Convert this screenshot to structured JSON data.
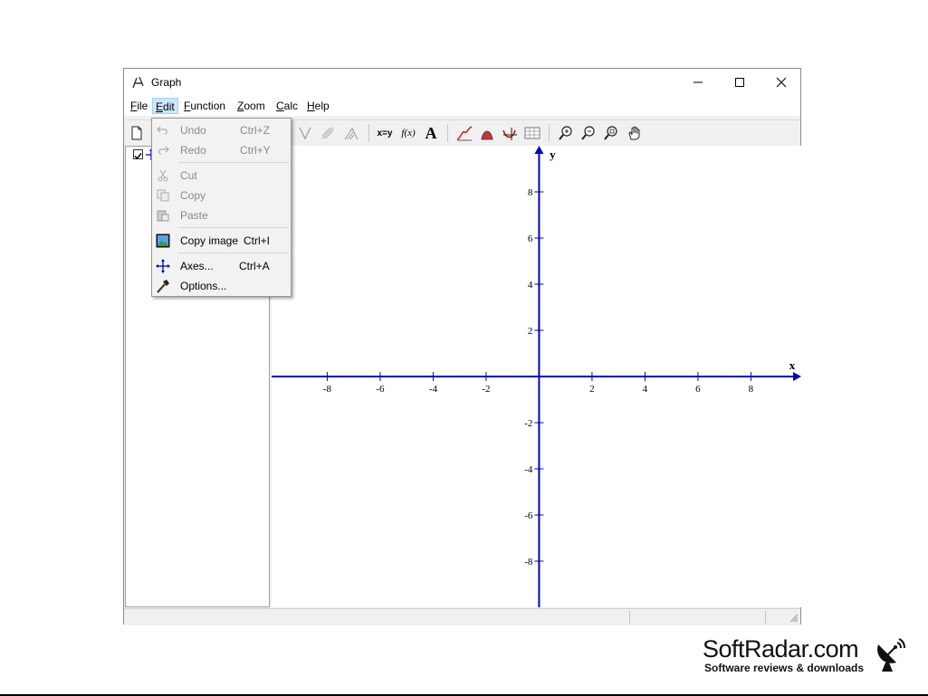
{
  "window": {
    "title": "Graph",
    "app_icon": "graph-app-icon"
  },
  "window_controls": {
    "minimize": "minimize-icon",
    "maximize": "maximize-icon",
    "close": "close-icon"
  },
  "menubar": {
    "items": [
      {
        "label": "File",
        "hotkey": "F",
        "rest": "ile"
      },
      {
        "label": "Edit",
        "hotkey": "E",
        "rest": "dit"
      },
      {
        "label": "Function",
        "hotkey": "F",
        "rest": "unction"
      },
      {
        "label": "Zoom",
        "hotkey": "Z",
        "rest": "oom"
      },
      {
        "label": "Calc",
        "hotkey": "C",
        "rest": "alc"
      },
      {
        "label": "Help",
        "hotkey": "H",
        "rest": "elp"
      }
    ]
  },
  "edit_menu": {
    "items": [
      {
        "label": "Undo",
        "shortcut": "Ctrl+Z",
        "enabled": false,
        "icon": "undo-icon"
      },
      {
        "label": "Redo",
        "shortcut": "Ctrl+Y",
        "enabled": false,
        "icon": "redo-icon"
      },
      {
        "label": "Cut",
        "shortcut": "",
        "enabled": false,
        "icon": "scissors-icon"
      },
      {
        "label": "Copy",
        "shortcut": "",
        "enabled": false,
        "icon": "copy-icon"
      },
      {
        "label": "Paste",
        "shortcut": "",
        "enabled": false,
        "icon": "paste-icon"
      },
      {
        "label": "Copy image",
        "shortcut": "Ctrl+I",
        "enabled": true,
        "icon": "image-icon"
      },
      {
        "label": "Axes...",
        "shortcut": "Ctrl+A",
        "enabled": true,
        "icon": "axes-icon"
      },
      {
        "label": "Options...",
        "shortcut": "",
        "enabled": true,
        "icon": "hammer-icon"
      }
    ]
  },
  "toolbar": {
    "icons": [
      "new-file-icon",
      "tangent-icon",
      "relation-icon",
      "shading-icon",
      "insert-point-series-icon",
      "evaluate-xy-label",
      "evaluate-fx-label",
      "insert-text-icon",
      "insert-function-icon",
      "insert-shade-icon",
      "insert-tangent-icon",
      "table-icon",
      "zoom-in-icon",
      "zoom-out-icon",
      "zoom-square-icon",
      "pan-hand-icon"
    ],
    "xy_label": "x=y",
    "fx_label": "f(x)",
    "text_label": "A"
  },
  "plot": {
    "x_axis_label": "x",
    "y_axis_label": "y",
    "x_ticks": [
      -8,
      -6,
      -4,
      -2,
      2,
      4,
      6,
      8
    ],
    "y_ticks": [
      8,
      6,
      4,
      2,
      -2,
      -4,
      -6,
      -8
    ],
    "xlim": [
      -10.1,
      9.9
    ],
    "ylim": [
      -10,
      10
    ],
    "axis_color": "#0000cc"
  },
  "watermark": {
    "brand": "SoftRadar.com",
    "tagline": "Software reviews & downloads"
  }
}
